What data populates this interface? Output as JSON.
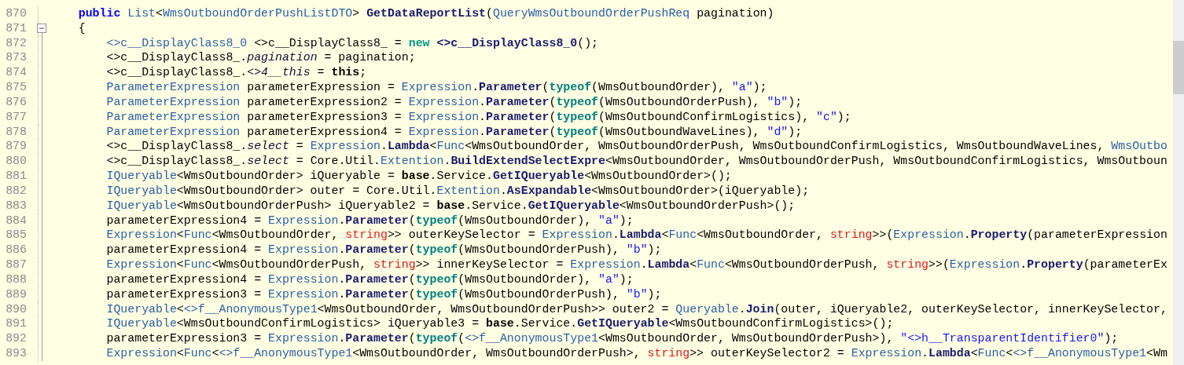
{
  "editor": {
    "lines": [
      {
        "number": "870",
        "kind": "member",
        "tokens": [
          {
            "kind": "keyword",
            "text": "public"
          },
          {
            "kind": "type",
            "text": " List"
          },
          {
            "kind": "plain",
            "text": "<"
          },
          {
            "kind": "type",
            "text": "WmsOutboundOrderPushListDTO"
          },
          {
            "kind": "plain",
            "text": "> "
          },
          {
            "kind": "method",
            "text": "GetDataReportList"
          },
          {
            "kind": "plain",
            "text": "("
          },
          {
            "kind": "type",
            "text": "QueryWmsOutboundOrderPushReq"
          },
          {
            "kind": "plain",
            "text": " pagination)"
          }
        ]
      },
      {
        "number": "871",
        "kind": "member",
        "fold": {
          "expanded": true
        },
        "tokens": [
          {
            "kind": "plain",
            "text": "{"
          }
        ]
      },
      {
        "number": "872",
        "kind": "statement",
        "tokens": [
          {
            "kind": "type",
            "text": "<>c__DisplayClass8_0"
          },
          {
            "kind": "plain",
            "text": " <>c__DisplayClass8_ = "
          },
          {
            "kind": "new",
            "text": "new"
          },
          {
            "kind": "method",
            "text": " <>c__DisplayClass8_0"
          },
          {
            "kind": "plain",
            "text": "();"
          }
        ]
      },
      {
        "number": "873",
        "kind": "statement",
        "tokens": [
          {
            "kind": "plain",
            "text": "<>c__DisplayClass8_."
          },
          {
            "kind": "field",
            "text": "pagination"
          },
          {
            "kind": "plain",
            "text": " = pagination;"
          }
        ]
      },
      {
        "number": "874",
        "kind": "statement",
        "tokens": [
          {
            "kind": "plain",
            "text": "<>c__DisplayClass8_."
          },
          {
            "kind": "field",
            "text": "<>4__this"
          },
          {
            "kind": "plain",
            "text": " = "
          },
          {
            "kind": "bold",
            "text": "this"
          },
          {
            "kind": "plain",
            "text": ";"
          }
        ]
      },
      {
        "number": "875",
        "kind": "statement",
        "tokens": [
          {
            "kind": "type",
            "text": "ParameterExpression"
          },
          {
            "kind": "plain",
            "text": " parameterExpression = "
          },
          {
            "kind": "type",
            "text": "Expression"
          },
          {
            "kind": "plain",
            "text": "."
          },
          {
            "kind": "method",
            "text": "Parameter"
          },
          {
            "kind": "plain",
            "text": "("
          },
          {
            "kind": "typeof",
            "text": "typeof"
          },
          {
            "kind": "plain",
            "text": "(WmsOutboundOrder), "
          },
          {
            "kind": "string",
            "text": "\"a\""
          },
          {
            "kind": "plain",
            "text": ");"
          }
        ]
      },
      {
        "number": "876",
        "kind": "statement",
        "tokens": [
          {
            "kind": "type",
            "text": "ParameterExpression"
          },
          {
            "kind": "plain",
            "text": " parameterExpression2 = "
          },
          {
            "kind": "type",
            "text": "Expression"
          },
          {
            "kind": "plain",
            "text": "."
          },
          {
            "kind": "method",
            "text": "Parameter"
          },
          {
            "kind": "plain",
            "text": "("
          },
          {
            "kind": "typeof",
            "text": "typeof"
          },
          {
            "kind": "plain",
            "text": "(WmsOutboundOrderPush), "
          },
          {
            "kind": "string",
            "text": "\"b\""
          },
          {
            "kind": "plain",
            "text": ");"
          }
        ]
      },
      {
        "number": "877",
        "kind": "statement",
        "tokens": [
          {
            "kind": "type",
            "text": "ParameterExpression"
          },
          {
            "kind": "plain",
            "text": " parameterExpression3 = "
          },
          {
            "kind": "type",
            "text": "Expression"
          },
          {
            "kind": "plain",
            "text": "."
          },
          {
            "kind": "method",
            "text": "Parameter"
          },
          {
            "kind": "plain",
            "text": "("
          },
          {
            "kind": "typeof",
            "text": "typeof"
          },
          {
            "kind": "plain",
            "text": "(WmsOutboundConfirmLogistics), "
          },
          {
            "kind": "string",
            "text": "\"c\""
          },
          {
            "kind": "plain",
            "text": ");"
          }
        ]
      },
      {
        "number": "878",
        "kind": "statement",
        "tokens": [
          {
            "kind": "type",
            "text": "ParameterExpression"
          },
          {
            "kind": "plain",
            "text": " parameterExpression4 = "
          },
          {
            "kind": "type",
            "text": "Expression"
          },
          {
            "kind": "plain",
            "text": "."
          },
          {
            "kind": "method",
            "text": "Parameter"
          },
          {
            "kind": "plain",
            "text": "("
          },
          {
            "kind": "typeof",
            "text": "typeof"
          },
          {
            "kind": "plain",
            "text": "(WmsOutboundWaveLines), "
          },
          {
            "kind": "string",
            "text": "\"d\""
          },
          {
            "kind": "plain",
            "text": ");"
          }
        ]
      },
      {
        "number": "879",
        "kind": "statement",
        "tokens": [
          {
            "kind": "plain",
            "text": "<>c__DisplayClass8_."
          },
          {
            "kind": "field",
            "text": "select"
          },
          {
            "kind": "plain",
            "text": " = "
          },
          {
            "kind": "type",
            "text": "Expression"
          },
          {
            "kind": "plain",
            "text": "."
          },
          {
            "kind": "method",
            "text": "Lambda"
          },
          {
            "kind": "plain",
            "text": "<"
          },
          {
            "kind": "type",
            "text": "Func"
          },
          {
            "kind": "plain",
            "text": "<WmsOutboundOrder, WmsOutboundOrderPush, WmsOutboundConfirmLogistics, WmsOutboundWaveLines, "
          },
          {
            "kind": "type",
            "text": "WmsOutbo"
          }
        ]
      },
      {
        "number": "880",
        "kind": "statement",
        "tokens": [
          {
            "kind": "plain",
            "text": "<>c__DisplayClass8_."
          },
          {
            "kind": "field",
            "text": "select"
          },
          {
            "kind": "plain",
            "text": " = Core.Util."
          },
          {
            "kind": "type",
            "text": "Extention"
          },
          {
            "kind": "plain",
            "text": "."
          },
          {
            "kind": "method",
            "text": "BuildExtendSelectExpre"
          },
          {
            "kind": "plain",
            "text": "<WmsOutboundOrder, WmsOutboundOrderPush, WmsOutboundConfirmLogistics, WmsOutboun"
          }
        ]
      },
      {
        "number": "881",
        "kind": "statement",
        "tokens": [
          {
            "kind": "type",
            "text": "IQueryable"
          },
          {
            "kind": "plain",
            "text": "<WmsOutboundOrder> iQueryable = "
          },
          {
            "kind": "bold",
            "text": "base"
          },
          {
            "kind": "plain",
            "text": ".Service."
          },
          {
            "kind": "method",
            "text": "GetIQueryable"
          },
          {
            "kind": "plain",
            "text": "<WmsOutboundOrder>();"
          }
        ]
      },
      {
        "number": "882",
        "kind": "statement",
        "tokens": [
          {
            "kind": "type",
            "text": "IQueryable"
          },
          {
            "kind": "plain",
            "text": "<WmsOutboundOrder> outer = Core.Util."
          },
          {
            "kind": "type",
            "text": "Extention"
          },
          {
            "kind": "plain",
            "text": "."
          },
          {
            "kind": "method",
            "text": "AsExpandable"
          },
          {
            "kind": "plain",
            "text": "<WmsOutboundOrder>(iQueryable);"
          }
        ]
      },
      {
        "number": "883",
        "kind": "statement",
        "tokens": [
          {
            "kind": "type",
            "text": "IQueryable"
          },
          {
            "kind": "plain",
            "text": "<WmsOutboundOrderPush> iQueryable2 = "
          },
          {
            "kind": "bold",
            "text": "base"
          },
          {
            "kind": "plain",
            "text": ".Service."
          },
          {
            "kind": "method",
            "text": "GetIQueryable"
          },
          {
            "kind": "plain",
            "text": "<WmsOutboundOrderPush>();"
          }
        ]
      },
      {
        "number": "884",
        "kind": "statement",
        "tokens": [
          {
            "kind": "plain",
            "text": "parameterExpression4 = "
          },
          {
            "kind": "type",
            "text": "Expression"
          },
          {
            "kind": "plain",
            "text": "."
          },
          {
            "kind": "method",
            "text": "Parameter"
          },
          {
            "kind": "plain",
            "text": "("
          },
          {
            "kind": "typeof",
            "text": "typeof"
          },
          {
            "kind": "plain",
            "text": "(WmsOutboundOrder), "
          },
          {
            "kind": "string",
            "text": "\"a\""
          },
          {
            "kind": "plain",
            "text": ");"
          }
        ]
      },
      {
        "number": "885",
        "kind": "statement",
        "tokens": [
          {
            "kind": "type",
            "text": "Expression"
          },
          {
            "kind": "plain",
            "text": "<"
          },
          {
            "kind": "type",
            "text": "Func"
          },
          {
            "kind": "plain",
            "text": "<WmsOutboundOrder, "
          },
          {
            "kind": "keyword_red",
            "text": "string"
          },
          {
            "kind": "plain",
            "text": ">> outerKeySelector = "
          },
          {
            "kind": "type",
            "text": "Expression"
          },
          {
            "kind": "plain",
            "text": "."
          },
          {
            "kind": "method",
            "text": "Lambda"
          },
          {
            "kind": "plain",
            "text": "<"
          },
          {
            "kind": "type",
            "text": "Func"
          },
          {
            "kind": "plain",
            "text": "<WmsOutboundOrder, "
          },
          {
            "kind": "keyword_red",
            "text": "string"
          },
          {
            "kind": "plain",
            "text": ">>("
          },
          {
            "kind": "type",
            "text": "Expression"
          },
          {
            "kind": "plain",
            "text": "."
          },
          {
            "kind": "method",
            "text": "Property"
          },
          {
            "kind": "plain",
            "text": "(parameterExpression"
          }
        ]
      },
      {
        "number": "886",
        "kind": "statement",
        "tokens": [
          {
            "kind": "plain",
            "text": "parameterExpression4 = "
          },
          {
            "kind": "type",
            "text": "Expression"
          },
          {
            "kind": "plain",
            "text": "."
          },
          {
            "kind": "method",
            "text": "Parameter"
          },
          {
            "kind": "plain",
            "text": "("
          },
          {
            "kind": "typeof",
            "text": "typeof"
          },
          {
            "kind": "plain",
            "text": "(WmsOutboundOrderPush), "
          },
          {
            "kind": "string",
            "text": "\"b\""
          },
          {
            "kind": "plain",
            "text": ");"
          }
        ]
      },
      {
        "number": "887",
        "kind": "statement",
        "tokens": [
          {
            "kind": "type",
            "text": "Expression"
          },
          {
            "kind": "plain",
            "text": "<"
          },
          {
            "kind": "type",
            "text": "Func"
          },
          {
            "kind": "plain",
            "text": "<WmsOutboundOrderPush, "
          },
          {
            "kind": "keyword_red",
            "text": "string"
          },
          {
            "kind": "plain",
            "text": ">> innerKeySelector = "
          },
          {
            "kind": "type",
            "text": "Expression"
          },
          {
            "kind": "plain",
            "text": "."
          },
          {
            "kind": "method",
            "text": "Lambda"
          },
          {
            "kind": "plain",
            "text": "<"
          },
          {
            "kind": "type",
            "text": "Func"
          },
          {
            "kind": "plain",
            "text": "<WmsOutboundOrderPush, "
          },
          {
            "kind": "keyword_red",
            "text": "string"
          },
          {
            "kind": "plain",
            "text": ">>("
          },
          {
            "kind": "type",
            "text": "Expression"
          },
          {
            "kind": "plain",
            "text": "."
          },
          {
            "kind": "method",
            "text": "Property"
          },
          {
            "kind": "plain",
            "text": "(parameterEx"
          }
        ]
      },
      {
        "number": "888",
        "kind": "statement",
        "tokens": [
          {
            "kind": "plain",
            "text": "parameterExpression4 = "
          },
          {
            "kind": "type",
            "text": "Expression"
          },
          {
            "kind": "plain",
            "text": "."
          },
          {
            "kind": "method",
            "text": "Parameter"
          },
          {
            "kind": "plain",
            "text": "("
          },
          {
            "kind": "typeof",
            "text": "typeof"
          },
          {
            "kind": "plain",
            "text": "(WmsOutboundOrder), "
          },
          {
            "kind": "string",
            "text": "\"a\""
          },
          {
            "kind": "plain",
            "text": ");"
          }
        ]
      },
      {
        "number": "889",
        "kind": "statement",
        "tokens": [
          {
            "kind": "plain",
            "text": "parameterExpression3 = "
          },
          {
            "kind": "type",
            "text": "Expression"
          },
          {
            "kind": "plain",
            "text": "."
          },
          {
            "kind": "method",
            "text": "Parameter"
          },
          {
            "kind": "plain",
            "text": "("
          },
          {
            "kind": "typeof",
            "text": "typeof"
          },
          {
            "kind": "plain",
            "text": "(WmsOutboundOrderPush), "
          },
          {
            "kind": "string",
            "text": "\"b\""
          },
          {
            "kind": "plain",
            "text": ");"
          }
        ]
      },
      {
        "number": "890",
        "kind": "statement",
        "tokens": [
          {
            "kind": "type",
            "text": "IQueryable"
          },
          {
            "kind": "plain",
            "text": "<"
          },
          {
            "kind": "type",
            "text": "<>f__AnonymousType1"
          },
          {
            "kind": "plain",
            "text": "<WmsOutboundOrder, WmsOutboundOrderPush>> outer2 = "
          },
          {
            "kind": "type",
            "text": "Queryable"
          },
          {
            "kind": "plain",
            "text": "."
          },
          {
            "kind": "method",
            "text": "Join"
          },
          {
            "kind": "plain",
            "text": "(outer, iQueryable2, outerKeySelector, innerKeySelector,"
          }
        ]
      },
      {
        "number": "891",
        "kind": "statement",
        "tokens": [
          {
            "kind": "type",
            "text": "IQueryable"
          },
          {
            "kind": "plain",
            "text": "<WmsOutboundConfirmLogistics> iQueryable3 = "
          },
          {
            "kind": "bold",
            "text": "base"
          },
          {
            "kind": "plain",
            "text": ".Service."
          },
          {
            "kind": "method",
            "text": "GetIQueryable"
          },
          {
            "kind": "plain",
            "text": "<WmsOutboundConfirmLogistics>();"
          }
        ]
      },
      {
        "number": "892",
        "kind": "statement",
        "tokens": [
          {
            "kind": "plain",
            "text": "parameterExpression3 = "
          },
          {
            "kind": "type",
            "text": "Expression"
          },
          {
            "kind": "plain",
            "text": "."
          },
          {
            "kind": "method",
            "text": "Parameter"
          },
          {
            "kind": "plain",
            "text": "("
          },
          {
            "kind": "typeof",
            "text": "typeof"
          },
          {
            "kind": "plain",
            "text": "("
          },
          {
            "kind": "type",
            "text": "<>f__AnonymousType1"
          },
          {
            "kind": "plain",
            "text": "<WmsOutboundOrder, WmsOutboundOrderPush>), "
          },
          {
            "kind": "string",
            "text": "\"<>h__TransparentIdentifier0\""
          },
          {
            "kind": "plain",
            "text": ");"
          }
        ]
      },
      {
        "number": "893",
        "kind": "statement",
        "tokens": [
          {
            "kind": "type",
            "text": "Expression"
          },
          {
            "kind": "plain",
            "text": "<"
          },
          {
            "kind": "type",
            "text": "Func"
          },
          {
            "kind": "plain",
            "text": "<"
          },
          {
            "kind": "type",
            "text": "<>f__AnonymousType1"
          },
          {
            "kind": "plain",
            "text": "<WmsOutboundOrder, WmsOutboundOrderPush>, "
          },
          {
            "kind": "keyword_red",
            "text": "string"
          },
          {
            "kind": "plain",
            "text": ">> outerKeySelector2 = "
          },
          {
            "kind": "type",
            "text": "Expression"
          },
          {
            "kind": "plain",
            "text": "."
          },
          {
            "kind": "method",
            "text": "Lambda"
          },
          {
            "kind": "plain",
            "text": "<"
          },
          {
            "kind": "type",
            "text": "Func"
          },
          {
            "kind": "plain",
            "text": "<"
          },
          {
            "kind": "type",
            "text": "<>f__AnonymousType1"
          },
          {
            "kind": "plain",
            "text": "<Wm"
          }
        ]
      }
    ]
  }
}
